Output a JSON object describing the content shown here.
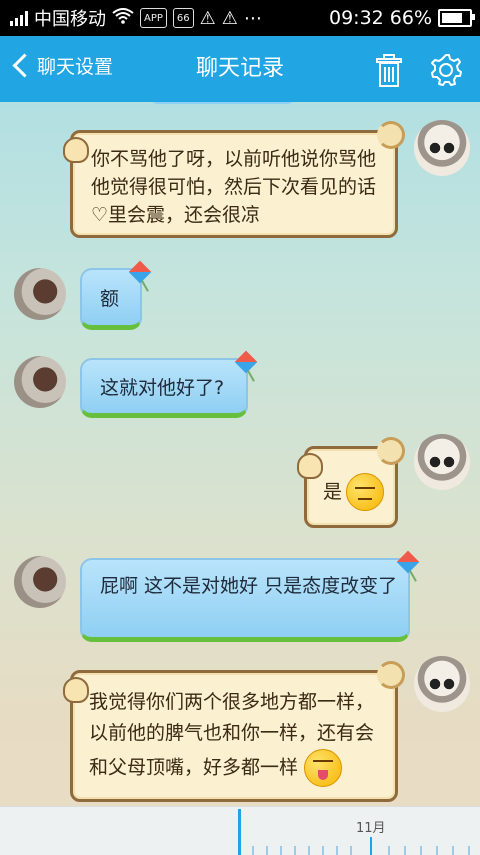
{
  "status_bar": {
    "carrier": "中国移动",
    "badge_app": "APP",
    "badge_66": "66",
    "time": "09:32",
    "battery_text": "66%",
    "battery_level": 0.66
  },
  "header": {
    "back_label": "聊天设置",
    "title": "聊天记录",
    "icons": {
      "back": "chevron-left-icon",
      "trash": "trash-icon",
      "settings": "gear-icon"
    },
    "accent_color": "#21a5e3"
  },
  "messages": [
    {
      "side": "self",
      "style": "parchment",
      "text": "你不骂他了呀，以前听他说你骂他他觉得很可怕，然后下次看见的话♡里会震，还会很凉"
    },
    {
      "side": "other",
      "style": "blue",
      "text": "额"
    },
    {
      "side": "other",
      "style": "blue",
      "text": "这就对他好了?"
    },
    {
      "side": "self",
      "style": "parchment",
      "text": "是",
      "emoji": "unamused-emoji"
    },
    {
      "side": "other",
      "style": "blue",
      "text": "屁啊  这不是对她好 只是态度改变了"
    },
    {
      "side": "self",
      "style": "parchment",
      "text": "我觉得你们两个很多地方都一样，以前他的脾气也和你一样，还有会和父母顶嘴，好多都一样",
      "emoji": "tongue-emoji"
    }
  ],
  "timeline": {
    "month_label": "11月"
  }
}
